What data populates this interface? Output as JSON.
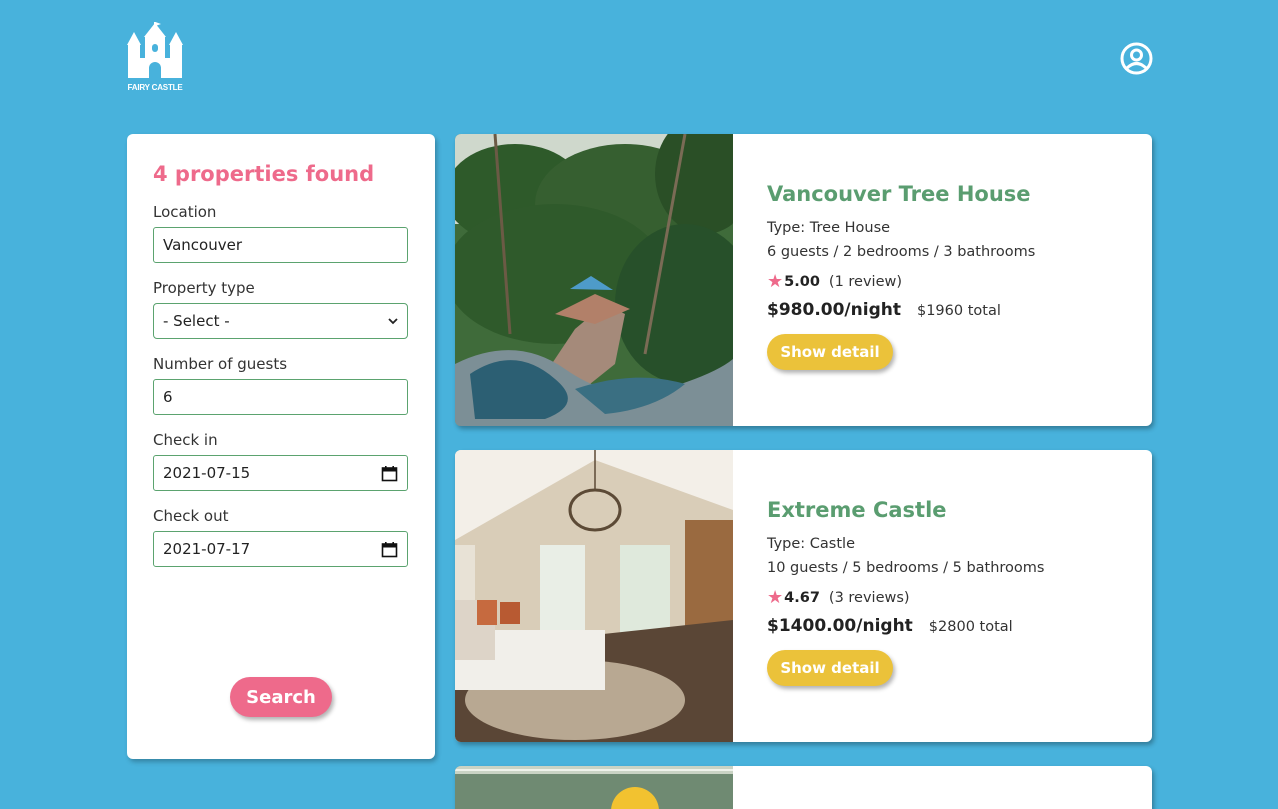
{
  "header": {
    "logo_text": "FAIRY CASTLE"
  },
  "colors": {
    "background": "#48b2dc",
    "accent_pink": "#ee6a8b",
    "title_green": "#5a9d70",
    "button_yellow": "#ebc23a"
  },
  "filters": {
    "results_count": "4 properties found",
    "location_label": "Location",
    "location_value": "Vancouver",
    "property_type_label": "Property type",
    "property_type_value": "- Select -",
    "guests_label": "Number of guests",
    "guests_value": "6",
    "check_in_label": "Check in",
    "check_in_value": "2021-07-15",
    "check_out_label": "Check out",
    "check_out_value": "2021-07-17",
    "search_label": "Search"
  },
  "listings": [
    {
      "title": "Vancouver Tree House",
      "type": "Type: Tree House",
      "capacity": "6 guests / 2 bedrooms / 3 bathrooms",
      "rating": "5.00",
      "reviews": "(1 review)",
      "price": "$980.00/night",
      "total": "$1960 total",
      "button": "Show detail",
      "image": "tropical-tree-house-pool"
    },
    {
      "title": "Extreme Castle",
      "type": "Type: Castle",
      "capacity": "10 guests / 5 bedrooms / 5 bathrooms",
      "rating": "4.67",
      "reviews": "(3 reviews)",
      "price": "$1400.00/night",
      "total": "$2800 total",
      "button": "Show detail",
      "image": "bedroom-with-chandelier"
    }
  ]
}
